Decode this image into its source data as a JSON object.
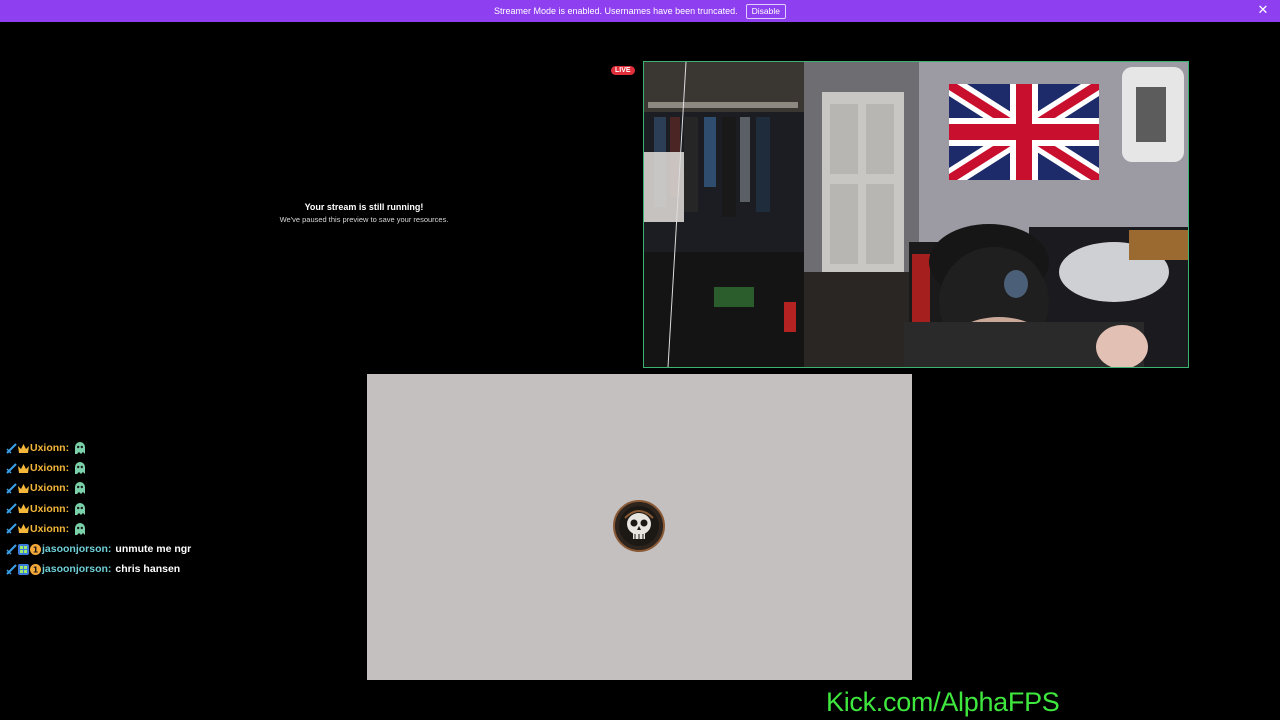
{
  "banner": {
    "message": "Streamer Mode is enabled. Usernames have been truncated.",
    "disable_label": "Disable",
    "close_icon": "close-icon",
    "color": "#8e3ff0"
  },
  "preview": {
    "title": "Your stream is still running!",
    "subtitle": "We've paused this preview to save your resources."
  },
  "live_badge": "LIVE",
  "chat": {
    "messages": [
      {
        "user": "Uxionn:",
        "text": "",
        "badges": [
          "sword-icon",
          "crown-icon"
        ],
        "emote": "ghost-emote-icon",
        "user_color": "#f4b73a"
      },
      {
        "user": "Uxionn:",
        "text": "",
        "badges": [
          "sword-icon",
          "crown-icon"
        ],
        "emote": "ghost-emote-icon",
        "user_color": "#f4b73a"
      },
      {
        "user": "Uxionn:",
        "text": "",
        "badges": [
          "sword-icon",
          "crown-icon"
        ],
        "emote": "ghost-emote-icon",
        "user_color": "#f4b73a"
      },
      {
        "user": "Uxionn:",
        "text": "",
        "badges": [
          "sword-icon",
          "crown-icon"
        ],
        "emote": "ghost-emote-icon",
        "user_color": "#f4b73a"
      },
      {
        "user": "Uxionn:",
        "text": "",
        "badges": [
          "sword-icon",
          "crown-icon"
        ],
        "emote": "ghost-emote-icon",
        "user_color": "#f4b73a"
      },
      {
        "user": "jasoonjorson:",
        "text": "unmute me ngr",
        "badges": [
          "sword-icon",
          "grid-badge-icon",
          "one-month-icon"
        ],
        "emote": "",
        "user_color": "#6fd0d8"
      },
      {
        "user": "jasoonjorson:",
        "text": "chris hansen",
        "badges": [
          "sword-icon",
          "grid-badge-icon",
          "one-month-icon"
        ],
        "emote": "",
        "user_color": "#6fd0d8"
      }
    ]
  },
  "overlay_link": "Kick.com/AlphaFPS",
  "colors": {
    "accent_green": "#3ee63e",
    "live_red": "#e02f3a",
    "webcam_border": "#3cb371",
    "panel_grey": "#c4c0c0"
  }
}
